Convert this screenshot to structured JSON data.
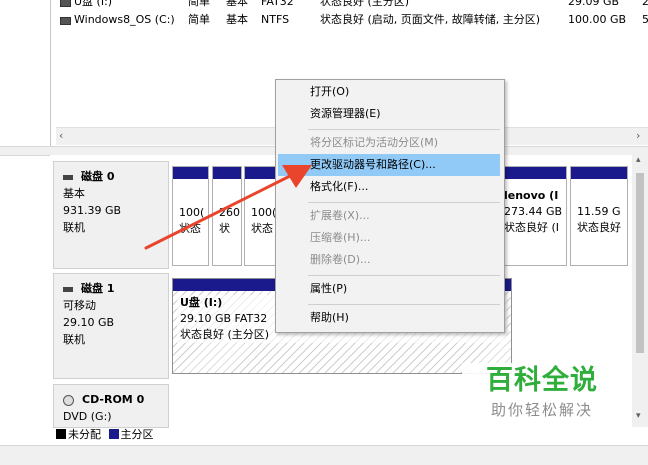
{
  "volumes": [
    {
      "name": "U盘 (I:)",
      "layout": "简单",
      "type": "基本",
      "fs": "FAT32",
      "status": "状态良好 (主分区)",
      "capacity": "29.09 GB",
      "free": "2"
    },
    {
      "name": "Windows8_OS (C:)",
      "layout": "简单",
      "type": "基本",
      "fs": "NTFS",
      "status": "状态良好 (启动, 页面文件, 故障转储, 主分区)",
      "capacity": "100.00 GB",
      "free": "5"
    }
  ],
  "disks": [
    {
      "name": "磁盘 0",
      "type": "基本",
      "size": "931.39 GB",
      "state": "联机"
    },
    {
      "name": "磁盘 1",
      "type": "可移动",
      "size": "29.10 GB",
      "state": "联机"
    },
    {
      "name": "CD-ROM 0",
      "type": "DVD (G:)"
    }
  ],
  "disk0_partitions": [
    {
      "line1": "100(",
      "line2": "状态"
    },
    {
      "line1": "260",
      "line2": "状"
    },
    {
      "line1": "100(",
      "line2": "状态"
    },
    {
      "line1": "lenovo  (I",
      "line2": "273.44 GB",
      "line3": "状态良好 (I"
    },
    {
      "line1": "",
      "line2": "11.59 G",
      "line3": "状态良好"
    }
  ],
  "disk1_partition": {
    "name": "U盘 (I:)",
    "size": "29.10 GB FAT32",
    "status": "状态良好 (主分区)"
  },
  "context_menu": [
    {
      "label": "打开(O)",
      "enabled": true
    },
    {
      "label": "资源管理器(E)",
      "enabled": true
    },
    {
      "label": "将分区标记为活动分区(M)",
      "enabled": false
    },
    {
      "label": "更改驱动器号和路径(C)...",
      "enabled": true,
      "highlighted": true
    },
    {
      "label": "格式化(F)...",
      "enabled": true
    },
    {
      "label": "扩展卷(X)...",
      "enabled": false
    },
    {
      "label": "压缩卷(H)...",
      "enabled": false
    },
    {
      "label": "删除卷(D)...",
      "enabled": false
    },
    {
      "label": "属性(P)",
      "enabled": true
    },
    {
      "label": "帮助(H)",
      "enabled": true
    }
  ],
  "legend": {
    "unallocated": "未分配",
    "primary": "主分区"
  },
  "watermark": {
    "title": "百科全说",
    "subtitle": "助你轻松解决"
  },
  "colors": {
    "primary_partition": "#1a1a8c",
    "unallocated": "#000000",
    "highlight": "#91c9f7",
    "arrow": "#e8452c",
    "watermark": "#2fae3c"
  }
}
